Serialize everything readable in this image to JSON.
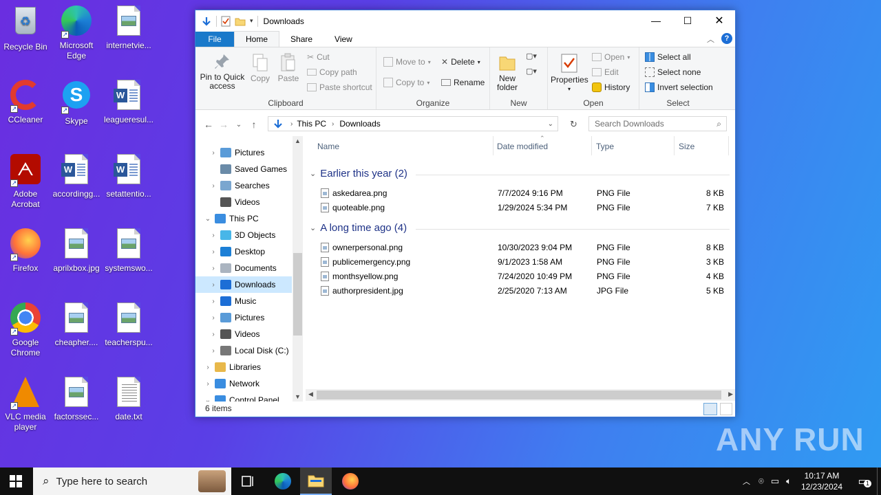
{
  "desktop": {
    "icons": [
      {
        "label": "Recycle Bin"
      },
      {
        "label": "Microsoft Edge"
      },
      {
        "label": "internetvie..."
      },
      {
        "label": "CCleaner"
      },
      {
        "label": "Skype"
      },
      {
        "label": "leagueresul..."
      },
      {
        "label": "Adobe Acrobat"
      },
      {
        "label": "accordingg..."
      },
      {
        "label": "setattentio..."
      },
      {
        "label": "Firefox"
      },
      {
        "label": "aprilxbox.jpg"
      },
      {
        "label": "systemswo..."
      },
      {
        "label": "Google Chrome"
      },
      {
        "label": "cheapher...."
      },
      {
        "label": "teacherspu..."
      },
      {
        "label": "VLC media player"
      },
      {
        "label": "factorssec..."
      },
      {
        "label": "date.txt"
      }
    ],
    "watermark": "ANY RUN"
  },
  "window": {
    "title": "Downloads",
    "controls": {
      "minimize": "—",
      "maximize": "☐",
      "close": "✕"
    },
    "menu_tabs": [
      "File",
      "Home",
      "Share",
      "View"
    ],
    "ribbon": {
      "clipboard": {
        "label": "Clipboard",
        "pin": "Pin to Quick access",
        "copy": "Copy",
        "paste": "Paste",
        "cut": "Cut",
        "copy_path": "Copy path",
        "paste_shortcut": "Paste shortcut"
      },
      "organize": {
        "label": "Organize",
        "move_to": "Move to",
        "copy_to": "Copy to",
        "delete": "Delete",
        "rename": "Rename"
      },
      "new": {
        "label": "New",
        "new_folder": "New folder"
      },
      "open": {
        "label": "Open",
        "properties": "Properties",
        "open": "Open",
        "edit": "Edit",
        "history": "History"
      },
      "select": {
        "label": "Select",
        "select_all": "Select all",
        "select_none": "Select none",
        "invert": "Invert selection"
      }
    },
    "address": {
      "crumbs": [
        "This PC",
        "Downloads"
      ],
      "search_placeholder": "Search Downloads"
    },
    "nav": [
      {
        "label": "Pictures",
        "indent": 1,
        "chev": "›"
      },
      {
        "label": "Saved Games",
        "indent": 1,
        "chev": ""
      },
      {
        "label": "Searches",
        "indent": 1,
        "chev": "›"
      },
      {
        "label": "Videos",
        "indent": 1,
        "chev": ""
      },
      {
        "label": "This PC",
        "indent": 0,
        "chev": "⌄"
      },
      {
        "label": "3D Objects",
        "indent": 1,
        "chev": "›"
      },
      {
        "label": "Desktop",
        "indent": 1,
        "chev": "›"
      },
      {
        "label": "Documents",
        "indent": 1,
        "chev": "›"
      },
      {
        "label": "Downloads",
        "indent": 1,
        "chev": "›"
      },
      {
        "label": "Music",
        "indent": 1,
        "chev": "›"
      },
      {
        "label": "Pictures",
        "indent": 1,
        "chev": "›"
      },
      {
        "label": "Videos",
        "indent": 1,
        "chev": "›"
      },
      {
        "label": "Local Disk (C:)",
        "indent": 1,
        "chev": "›"
      },
      {
        "label": "Libraries",
        "indent": 0,
        "chev": "›"
      },
      {
        "label": "Network",
        "indent": 0,
        "chev": "›"
      },
      {
        "label": "Control Panel",
        "indent": 0,
        "chev": "⌄"
      }
    ],
    "columns": [
      "Name",
      "Date modified",
      "Type",
      "Size"
    ],
    "groups": [
      {
        "title": "Earlier this year (2)",
        "files": [
          {
            "name": "askedarea.png",
            "date": "7/7/2024 9:16 PM",
            "type": "PNG File",
            "size": "8 KB"
          },
          {
            "name": "quoteable.png",
            "date": "1/29/2024 5:34 PM",
            "type": "PNG File",
            "size": "7 KB"
          }
        ]
      },
      {
        "title": "A long time ago (4)",
        "files": [
          {
            "name": "ownerpersonal.png",
            "date": "10/30/2023 9:04 PM",
            "type": "PNG File",
            "size": "8 KB"
          },
          {
            "name": "publicemergency.png",
            "date": "9/1/2023 1:58 AM",
            "type": "PNG File",
            "size": "3 KB"
          },
          {
            "name": "monthsyellow.png",
            "date": "7/24/2020 10:49 PM",
            "type": "PNG File",
            "size": "4 KB"
          },
          {
            "name": "authorpresident.jpg",
            "date": "2/25/2020 7:13 AM",
            "type": "JPG File",
            "size": "5 KB"
          }
        ]
      }
    ],
    "status": "6 items"
  },
  "taskbar": {
    "search_placeholder": "Type here to search",
    "time": "10:17 AM",
    "date": "12/23/2024",
    "notification_count": "1"
  },
  "colors": {
    "accent": "#1979ca",
    "selection": "#cce8ff",
    "group_header": "#1e3287",
    "taskbar": "#101010"
  }
}
